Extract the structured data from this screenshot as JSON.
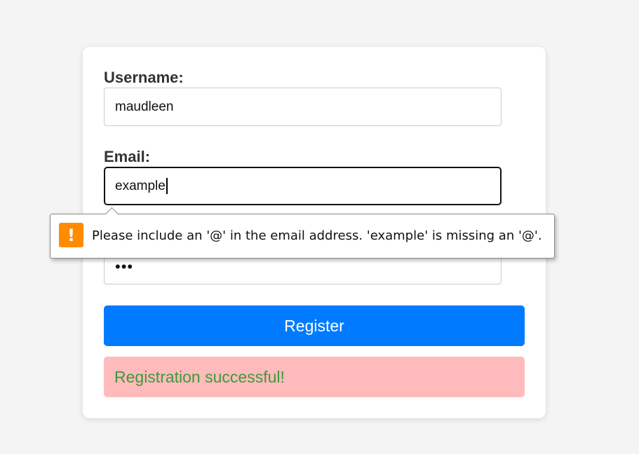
{
  "form": {
    "username": {
      "label": "Username:",
      "value": "maudleen"
    },
    "email": {
      "label": "Email:",
      "value": "example"
    },
    "password": {
      "value": "•••"
    },
    "register_label": "Register",
    "message": "Registration successful!"
  },
  "validation_tooltip": {
    "icon": "warning-icon",
    "icon_glyph": "!",
    "text": "Please include an '@' in the email address. 'example' is missing an '@'."
  },
  "colors": {
    "primary": "#007bff",
    "message_background": "#ffbbbb",
    "message_text": "#3a9a3a",
    "warning": "#ff8c00"
  }
}
